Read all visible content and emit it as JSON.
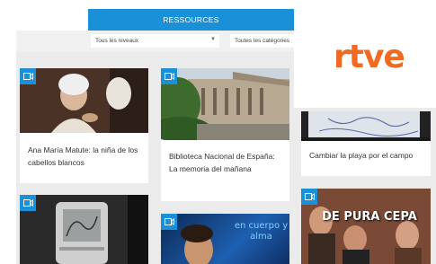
{
  "header": {
    "title": "RESSOURCES"
  },
  "filters": {
    "level": {
      "value": "Tous les niveaux"
    },
    "category": {
      "value": "Toutes les catégories"
    }
  },
  "logo": {
    "text": "rtve"
  },
  "cards": [
    {
      "title": "Ana María Matute: la niña de los cabellos blancos",
      "icon": "video-camera-icon"
    },
    {
      "title": "Biblioteca Nacional de España: La memoria del mañana",
      "icon": "video-camera-icon"
    },
    {
      "title": "Cambiar la playa por el campo",
      "icon": "video-camera-icon"
    },
    {
      "title": "",
      "icon": "video-camera-icon"
    },
    {
      "title": "",
      "icon": "video-camera-icon",
      "overlay_text": "en cuerpo y alma"
    },
    {
      "title": "",
      "icon": "video-camera-icon",
      "overlay_text": "DE PURA CEPA"
    }
  ],
  "colors": {
    "accent": "#1a90d9",
    "brand": "#f26a21"
  }
}
